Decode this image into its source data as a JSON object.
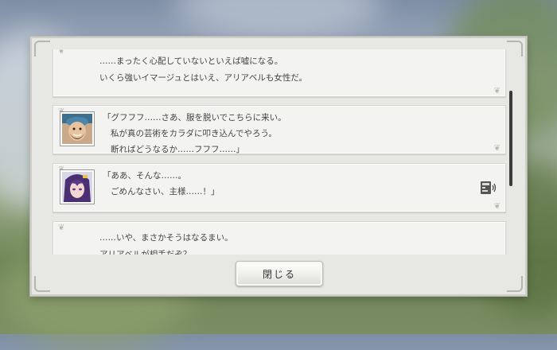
{
  "backlog": {
    "entries": [
      {
        "type": "narration",
        "lines": [
          "……まったく心配していないといえば嘘になる。",
          "いくら強いイマージュとはいえ、アリアベルも女性だ。"
        ]
      },
      {
        "type": "dialogue",
        "portrait": "bearded-man-portrait",
        "lines": [
          "「グフフフ……さあ、服を脱いでこちらに来い。",
          "私が真の芸術をカラダに叩き込んでやろう。",
          "断ればどうなるか……フフフ……」"
        ]
      },
      {
        "type": "dialogue",
        "portrait": "purple-haired-woman-portrait",
        "voice_icon": "voice-replay-icon",
        "lines": [
          "「ああ、そんな……。",
          "ごめんなさい、主様……！」"
        ]
      },
      {
        "type": "narration",
        "lines": [
          "……いや、まさかそうはなるまい。",
          "アリアベルが相手だぞ？"
        ]
      }
    ]
  },
  "close_button": {
    "label": "閉じる"
  },
  "colors": {
    "panel": "#e7e7e4",
    "entry": "#f3f3f1",
    "text": "#444444",
    "scroll_thumb": "#3a3a3a"
  }
}
